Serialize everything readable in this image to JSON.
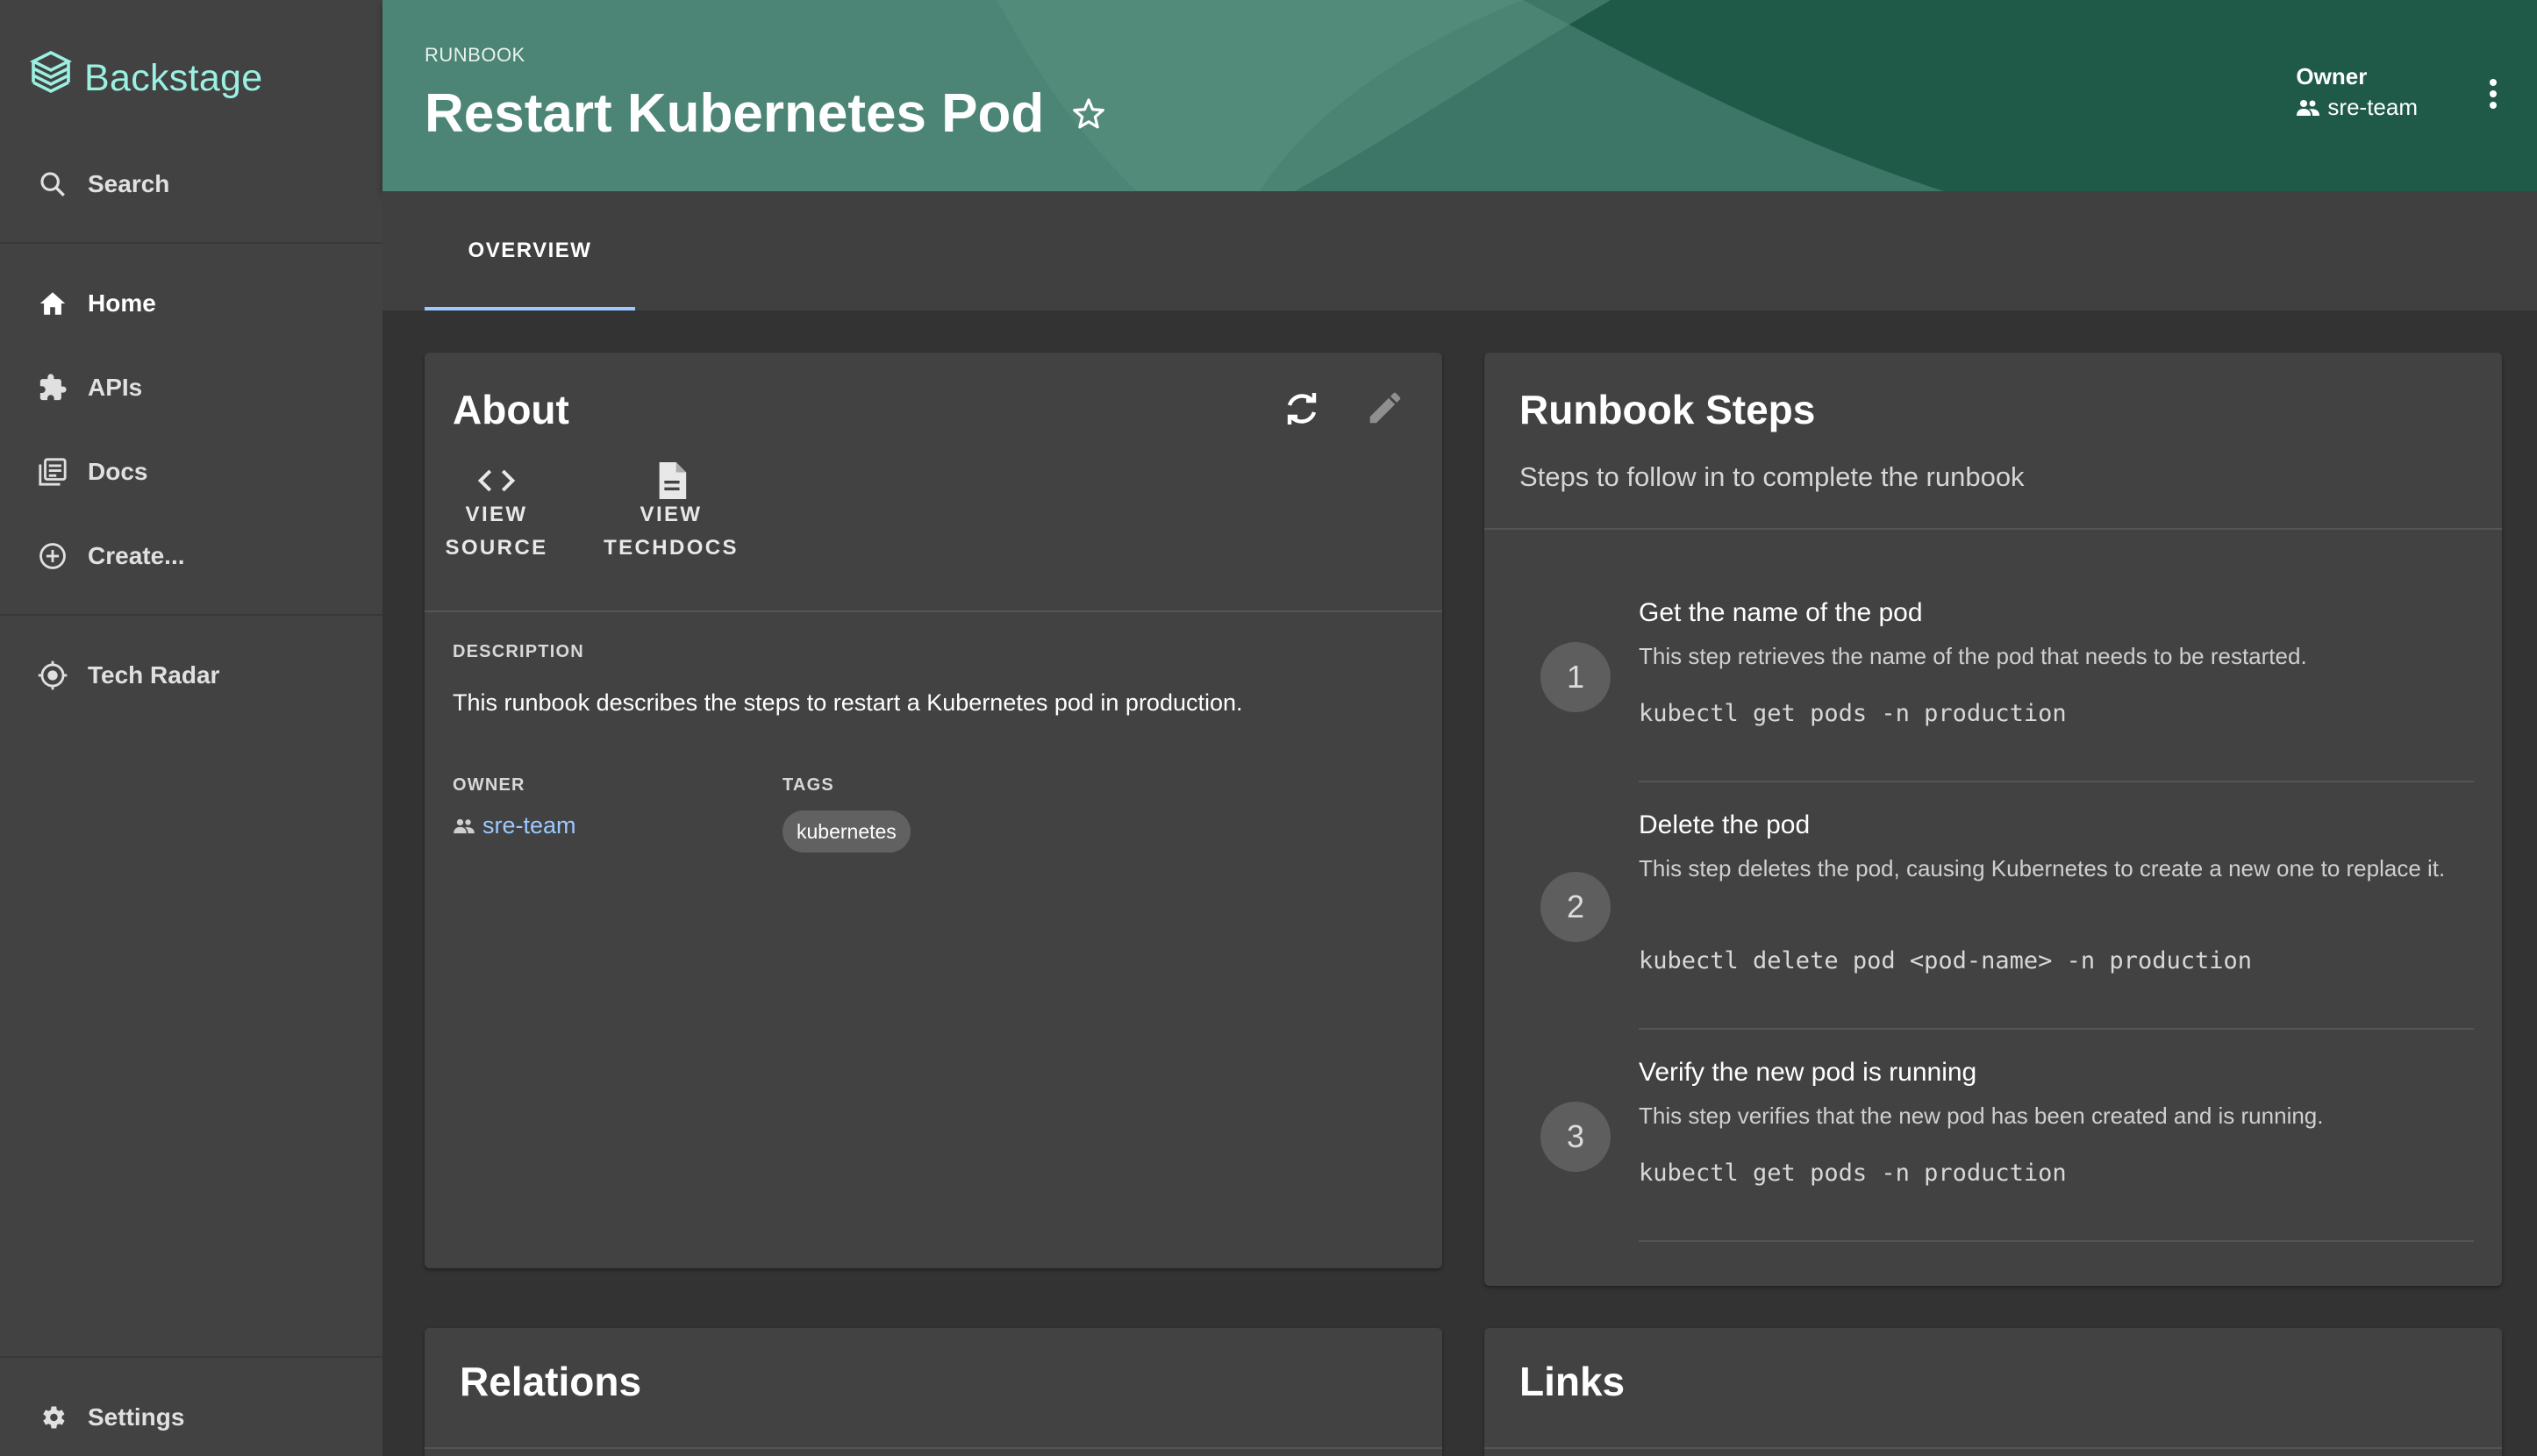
{
  "sidebar": {
    "app_name": "Backstage",
    "search_label": "Search",
    "items": [
      {
        "label": "Home",
        "icon": "home-icon"
      },
      {
        "label": "APIs",
        "icon": "puzzle-icon"
      },
      {
        "label": "Docs",
        "icon": "docs-icon"
      },
      {
        "label": "Create...",
        "icon": "add-circle-icon"
      }
    ],
    "tech_radar_label": "Tech Radar",
    "settings_label": "Settings"
  },
  "header": {
    "kind": "RUNBOOK",
    "title": "Restart Kubernetes Pod",
    "owner_label": "Owner",
    "owner_value": "sre-team"
  },
  "tabs": [
    {
      "label": "OVERVIEW",
      "selected": true
    }
  ],
  "about": {
    "title": "About",
    "view_source_line1": "VIEW",
    "view_source_line2": "SOURCE",
    "view_techdocs_line1": "VIEW",
    "view_techdocs_line2": "TECHDOCS",
    "description_label": "DESCRIPTION",
    "description": "This runbook describes the steps to restart a Kubernetes pod in production.",
    "owner_label": "OWNER",
    "owner_value": "sre-team",
    "tags_label": "TAGS",
    "tags": [
      "kubernetes"
    ]
  },
  "runbook": {
    "title": "Runbook Steps",
    "subtitle": "Steps to follow in to complete the runbook",
    "steps": [
      {
        "number": "1",
        "title": "Get the name of the pod",
        "description": "This step retrieves the name of the pod that needs to be restarted.",
        "command": "kubectl get pods -n production"
      },
      {
        "number": "2",
        "title": "Delete the pod",
        "description": "This step deletes the pod, causing Kubernetes to create a new one to replace it.",
        "command": "kubectl delete pod <pod-name> -n production"
      },
      {
        "number": "3",
        "title": "Verify the new pod is running",
        "description": "This step verifies that the new pod has been created and is running.",
        "command": "kubectl get pods -n production"
      }
    ]
  },
  "relations": {
    "title": "Relations"
  },
  "links": {
    "title": "Links"
  },
  "colors": {
    "header_bg": "#2f6b5a",
    "logo": "#9bf0e1",
    "tab_indicator": "#9cc9ff",
    "link": "#9cc9ff"
  }
}
